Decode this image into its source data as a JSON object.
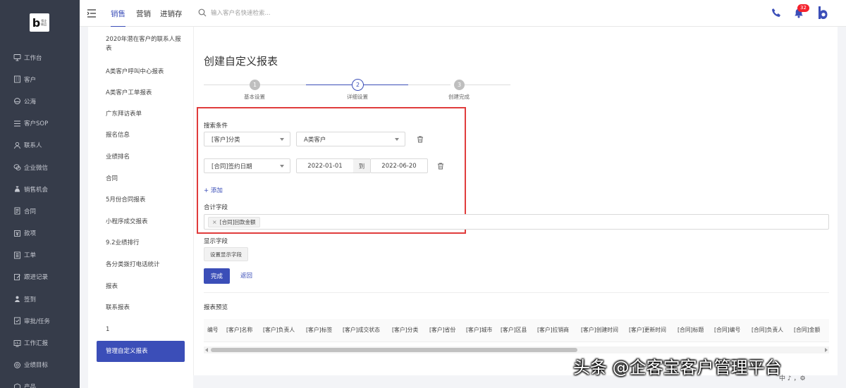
{
  "sidebar": {
    "logo_text": "b",
    "logo_sub": "悟企\n联品",
    "items": [
      {
        "label": "工作台",
        "icon": "monitor-icon"
      },
      {
        "label": "客户",
        "icon": "building-icon"
      },
      {
        "label": "公海",
        "icon": "pool-icon"
      },
      {
        "label": "客户SOP",
        "icon": "sop-icon"
      },
      {
        "label": "联系人",
        "icon": "user-icon"
      },
      {
        "label": "企业微信",
        "icon": "wechat-icon"
      },
      {
        "label": "销售机会",
        "icon": "moneybag-icon"
      },
      {
        "label": "合同",
        "icon": "contract-icon"
      },
      {
        "label": "款项",
        "icon": "payment-icon"
      },
      {
        "label": "工单",
        "icon": "ticket-icon"
      },
      {
        "label": "跟进记录",
        "icon": "edit-icon"
      },
      {
        "label": "签到",
        "icon": "location-icon"
      },
      {
        "label": "审批/任务",
        "icon": "approval-icon"
      },
      {
        "label": "工作汇报",
        "icon": "report-icon"
      },
      {
        "label": "业绩目标",
        "icon": "target-icon"
      },
      {
        "label": "产品",
        "icon": "product-icon"
      }
    ]
  },
  "topbar": {
    "tabs": [
      {
        "label": "销售",
        "active": true
      },
      {
        "label": "营销",
        "active": false
      },
      {
        "label": "进销存",
        "active": false
      }
    ],
    "search_placeholder": "输入客户名快速检索...",
    "notification_count": "32"
  },
  "report_list": {
    "items": [
      "2020年潜在客户的联系人报表",
      "A类客户呼叫中心报表",
      "A类客户工单报表",
      "广东拜访表单",
      "报名信息",
      "业绩排名",
      "合同",
      "5月份合同报表",
      "小程序成交报表",
      "9.2业绩排行",
      "各分类拨打电话统计",
      "报表",
      "联系报表",
      "1",
      "管理自定义报表"
    ],
    "active_index": 14
  },
  "main": {
    "title": "创建自定义报表",
    "steps": [
      {
        "number": "1",
        "label": "基本设置",
        "active": false
      },
      {
        "number": "2",
        "label": "详细设置",
        "active": true
      },
      {
        "number": "3",
        "label": "创建完成",
        "active": false
      }
    ],
    "search_conditions_label": "搜索条件",
    "condition1": {
      "field": "[客户]分类",
      "value": "A类客户"
    },
    "condition2": {
      "field": "[合同]签约日期",
      "start": "2022-01-01",
      "separator": "到",
      "end": "2022-06-20"
    },
    "add_label": "+ 添加",
    "sum_fields_label": "合计字段",
    "sum_field_tag": "[合同]回款金额",
    "display_fields_label": "显示字段",
    "display_fields_button": "设置显示字段",
    "finish_button": "完成",
    "back_link": "返回",
    "preview_label": "报表预览",
    "table_headers": [
      "编号",
      "[客户]名称",
      "[客户]负责人",
      "[客户]标签",
      "[客户]成交状态",
      "[客户]分类",
      "[客户]省份",
      "[客户]城市",
      "[客户]区县",
      "[客户]拉销商",
      "[客户]创建时间",
      "[客户]更新时间",
      "[合同]标题",
      "[合同]编号",
      "[合同]负责人",
      "[合同]金额"
    ]
  },
  "watermark": "头条 @企客宝客户管理平台",
  "corner_tools": "中 ♪ ，⚙"
}
